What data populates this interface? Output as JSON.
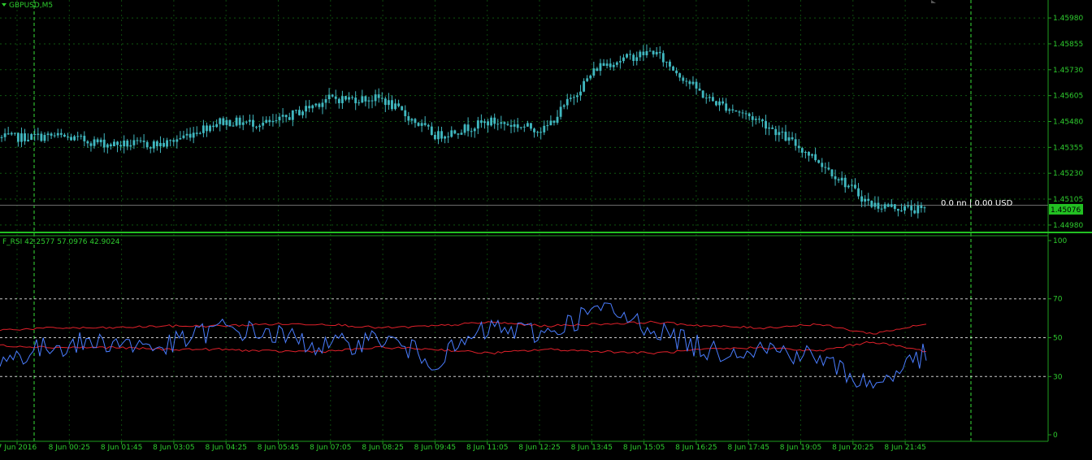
{
  "colors": {
    "background": "#000000",
    "grid": "#1e9e1e",
    "axis_text": "#2ecc2e",
    "candle": "#40b8c0",
    "rsi_line": "#4a7dff",
    "band_line": "#e0202a",
    "level_line": "#ffffff",
    "price_tag_bg": "#22c022",
    "price_tag_text": "#000000",
    "bid_line": "#6b6b6b",
    "separator": "#22c022"
  },
  "main_panel": {
    "symbol_label": "GBPUSD,M5",
    "position_text": "0.0 nn | 0.00 USD",
    "current_price": "1.45076",
    "y_tick_labels": [
      "1.45980",
      "1.45855",
      "1.45730",
      "1.45605",
      "1.45480",
      "1.45355",
      "1.45230",
      "1.45105",
      "1.44980"
    ]
  },
  "rsi_panel": {
    "indicator_label": "F_RSI 42.2577 57.0976 42.9024",
    "y_tick_labels": [
      "100",
      "70",
      "50",
      "30",
      "0"
    ]
  },
  "x_axis": {
    "tick_labels": [
      "7 Jun 2016",
      "8 Jun 00:25",
      "8 Jun 01:45",
      "8 Jun 03:05",
      "8 Jun 04:25",
      "8 Jun 05:45",
      "8 Jun 07:05",
      "8 Jun 08:25",
      "8 Jun 09:45",
      "8 Jun 11:05",
      "8 Jun 12:25",
      "8 Jun 13:45",
      "8 Jun 15:05",
      "8 Jun 16:25",
      "8 Jun 17:45",
      "8 Jun 19:05",
      "8 Jun 20:25",
      "8 Jun 21:45"
    ]
  },
  "chart_data": [
    {
      "type": "line",
      "title": "GBPUSD,M5",
      "xlabel": "",
      "ylabel": "",
      "ylim": [
        1.4496,
        1.46
      ],
      "grid": true,
      "x": [
        "7 Jun 2016",
        "8 Jun 00:25",
        "8 Jun 01:45",
        "8 Jun 03:05",
        "8 Jun 04:25",
        "8 Jun 05:45",
        "8 Jun 07:05",
        "8 Jun 08:25",
        "8 Jun 09:45",
        "8 Jun 11:05",
        "8 Jun 12:25",
        "8 Jun 13:45",
        "8 Jun 15:05",
        "8 Jun 16:25",
        "8 Jun 17:45",
        "8 Jun 19:05",
        "8 Jun 20:25",
        "8 Jun 21:45"
      ],
      "series": [
        {
          "values": [
            1.454,
            1.4541,
            1.4537,
            1.4537,
            1.4548,
            1.4547,
            1.4559,
            1.4559,
            1.4541,
            1.4548,
            1.4544,
            1.4575,
            1.4582,
            1.4559,
            1.4548,
            1.453,
            1.4508,
            1.4505
          ]
        }
      ]
    },
    {
      "type": "line",
      "title": "F_RSI 42.2577 57.0976 42.9024",
      "ylim": [
        0,
        100
      ],
      "levels": [
        70,
        50,
        30
      ],
      "grid": true,
      "x": [
        "7 Jun 2016",
        "8 Jun 00:25",
        "8 Jun 01:45",
        "8 Jun 03:05",
        "8 Jun 04:25",
        "8 Jun 05:45",
        "8 Jun 07:05",
        "8 Jun 08:25",
        "8 Jun 09:45",
        "8 Jun 11:05",
        "8 Jun 12:25",
        "8 Jun 13:45",
        "8 Jun 15:05",
        "8 Jun 16:25",
        "8 Jun 17:45",
        "8 Jun 19:05",
        "8 Jun 20:25",
        "8 Jun 21:45"
      ],
      "series": [
        {
          "values": [
            38,
            46,
            48,
            45,
            55,
            52,
            45,
            50,
            38,
            55,
            52,
            65,
            55,
            43,
            45,
            40,
            25,
            42
          ]
        },
        {
          "values": [
            54,
            55,
            55,
            56,
            56,
            57,
            57,
            55,
            56,
            58,
            56,
            57,
            58,
            56,
            55,
            57,
            52,
            57
          ]
        },
        {
          "values": [
            46,
            45,
            45,
            44,
            44,
            43,
            43,
            45,
            44,
            42,
            44,
            43,
            42,
            44,
            45,
            43,
            48,
            43
          ]
        }
      ]
    }
  ]
}
